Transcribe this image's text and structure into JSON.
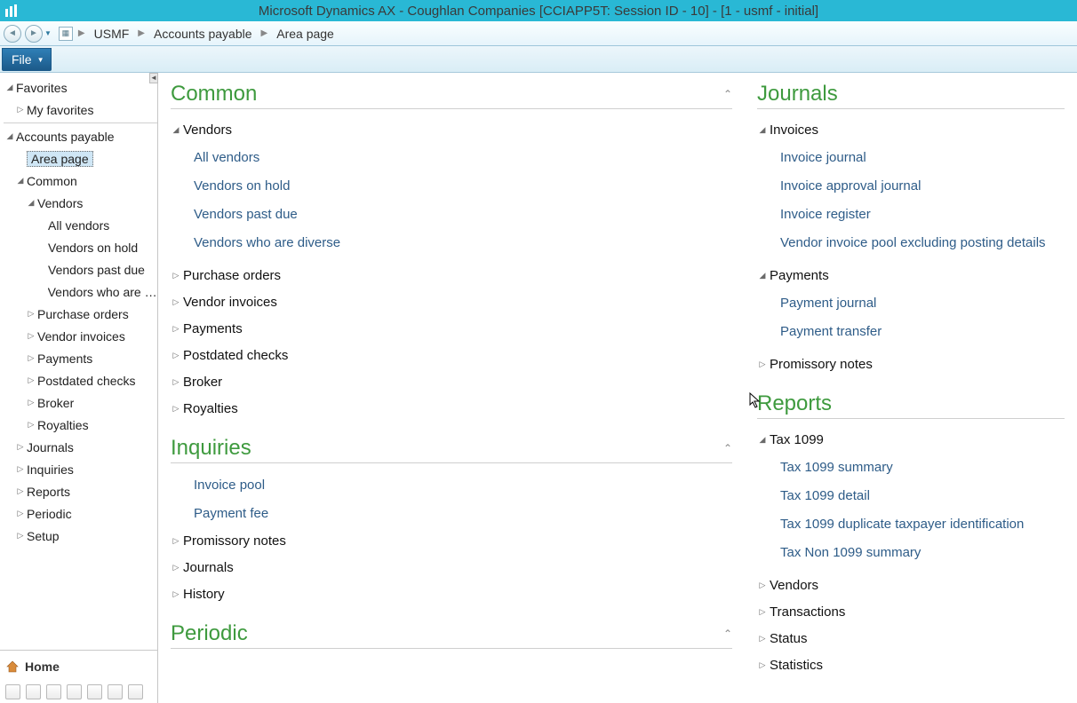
{
  "window": {
    "title": "Microsoft Dynamics AX - Coughlan Companies [CCIAPP5T: Session ID - 10]  -  [1 - usmf - initial]"
  },
  "breadcrumbs": {
    "b0": "USMF",
    "b1": "Accounts payable",
    "b2": "Area page"
  },
  "ribbon": {
    "file": "File"
  },
  "sidebar": {
    "favorites": "Favorites",
    "my_favorites": "My favorites",
    "ap": "Accounts payable",
    "area_page": "Area page",
    "common": "Common",
    "vendors": "Vendors",
    "all_vendors": "All vendors",
    "vendors_on_hold": "Vendors on hold",
    "vendors_past_due": "Vendors past due",
    "vendors_diverse": "Vendors who are d...",
    "purchase_orders": "Purchase orders",
    "vendor_invoices": "Vendor invoices",
    "payments": "Payments",
    "postdated": "Postdated checks",
    "broker": "Broker",
    "royalties": "Royalties",
    "journals": "Journals",
    "inquiries": "Inquiries",
    "reports": "Reports",
    "periodic": "Periodic",
    "setup": "Setup",
    "home": "Home"
  },
  "content": {
    "common": {
      "title": "Common",
      "vendors": "Vendors",
      "all_vendors": "All vendors",
      "vendors_on_hold": "Vendors on hold",
      "vendors_past_due": "Vendors past due",
      "vendors_diverse": "Vendors who are diverse",
      "purchase_orders": "Purchase orders",
      "vendor_invoices": "Vendor invoices",
      "payments": "Payments",
      "postdated": "Postdated checks",
      "broker": "Broker",
      "royalties": "Royalties"
    },
    "inquiries": {
      "title": "Inquiries",
      "invoice_pool": "Invoice pool",
      "payment_fee": "Payment fee",
      "promissory": "Promissory notes",
      "journals": "Journals",
      "history": "History"
    },
    "periodic": {
      "title": "Periodic"
    },
    "journals": {
      "title": "Journals",
      "invoices": "Invoices",
      "invoice_journal": "Invoice journal",
      "invoice_approval": "Invoice approval journal",
      "invoice_register": "Invoice register",
      "vendor_pool": "Vendor invoice pool excluding posting details",
      "payments": "Payments",
      "payment_journal": "Payment journal",
      "payment_transfer": "Payment transfer",
      "promissory": "Promissory notes"
    },
    "reports": {
      "title": "Reports",
      "tax1099": "Tax 1099",
      "tax_summary": "Tax 1099 summary",
      "tax_detail": "Tax 1099 detail",
      "tax_dup": "Tax 1099 duplicate taxpayer identification",
      "tax_non": "Tax Non 1099 summary",
      "vendors": "Vendors",
      "transactions": "Transactions",
      "status": "Status",
      "statistics": "Statistics"
    }
  }
}
